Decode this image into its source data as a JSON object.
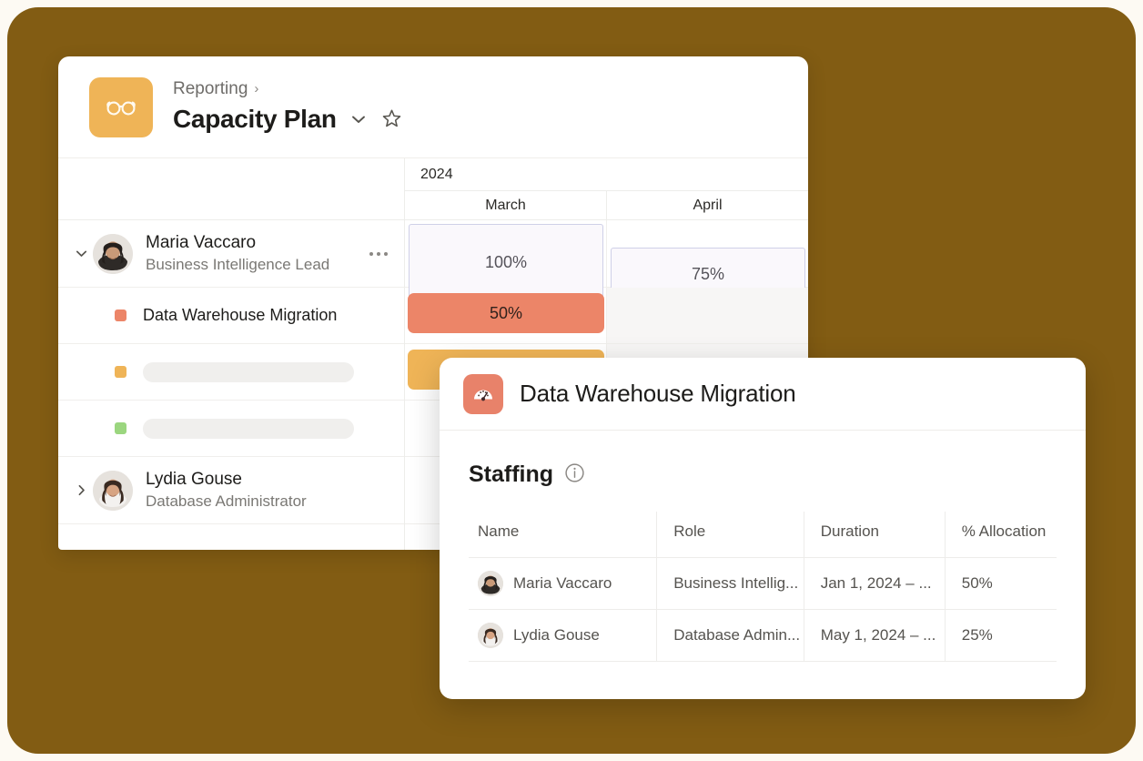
{
  "header": {
    "app_icon": "glasses-icon",
    "breadcrumb": "Reporting",
    "breadcrumb_separator": "›",
    "title": "Capacity Plan",
    "caret_icon": "chevron-down-icon",
    "star_icon": "star-icon"
  },
  "timeline": {
    "year": "2024",
    "months": [
      "March",
      "April"
    ]
  },
  "rows": [
    {
      "type": "person",
      "name": "Maria Vaccaro",
      "role": "Business Intelligence Lead",
      "expand_icon": "chevron-down-icon",
      "more_icon": "more-horizontal-icon",
      "capacity": [
        {
          "label": "100%",
          "style": "box"
        },
        {
          "label": "75%",
          "style": "box"
        }
      ]
    },
    {
      "type": "task",
      "name": "Data Warehouse Migration",
      "dot_color": "#ec8568",
      "bars": [
        {
          "label": "50%",
          "color": "#ec8568"
        }
      ]
    },
    {
      "type": "task",
      "name": "",
      "dot_color": "#efb457",
      "bars": [
        {
          "label": "",
          "color": "#efb457"
        }
      ]
    },
    {
      "type": "task",
      "name": "",
      "dot_color": "#9bd67f",
      "bars": []
    },
    {
      "type": "person",
      "name": "Lydia Gouse",
      "role": "Database Administrator",
      "expand_icon": "chevron-right-icon",
      "capacity": []
    }
  ],
  "detail_panel": {
    "icon": "gauge-icon",
    "title": "Data Warehouse Migration",
    "section": {
      "title": "Staffing",
      "info_icon": "info-icon"
    },
    "table": {
      "columns": [
        "Name",
        "Role",
        "Duration",
        "% Allocation"
      ],
      "rows": [
        {
          "name": "Maria Vaccaro",
          "role": "Business Intellig...",
          "duration": "Jan 1, 2024 – ...",
          "allocation": "50%"
        },
        {
          "name": "Lydia Gouse",
          "role": "Database Admin...",
          "duration": "May 1, 2024 – ...",
          "allocation": "25%"
        }
      ]
    }
  },
  "colors": {
    "backdrop": "#825c13",
    "accent_amber": "#efb457",
    "accent_coral": "#ec8568",
    "accent_green": "#9bd67f",
    "capacity_box_border": "#cfd0e8"
  }
}
